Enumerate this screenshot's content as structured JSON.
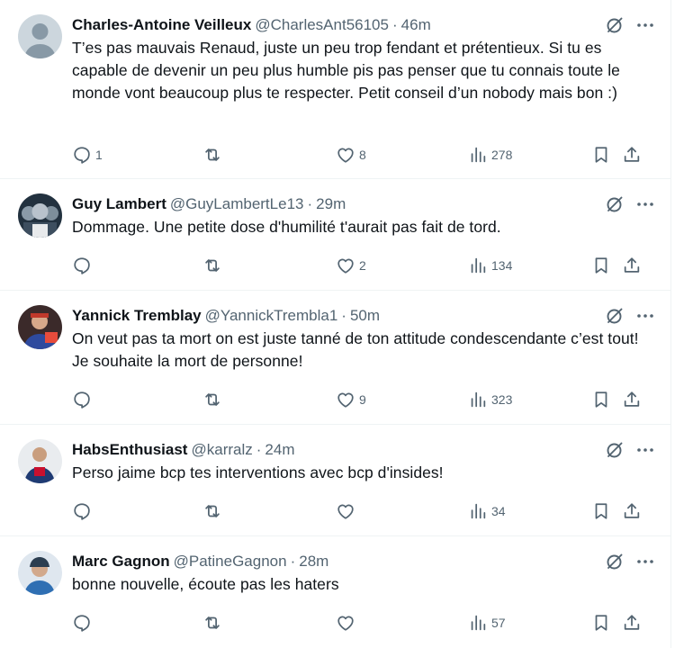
{
  "tweets": [
    {
      "name": "Charles-Antoine Veilleux",
      "handle": "@CharlesAnt56105",
      "time": "46m",
      "text": "T’es pas mauvais Renaud, juste un peu trop fendant et prétentieux. Si tu es capable de devenir un peu plus humble pis pas penser que tu connais toute le monde vont beaucoup plus te respecter. Petit conseil d’un nobody mais bon :)",
      "replies": "1",
      "retweets": "",
      "likes": "8",
      "views": "278"
    },
    {
      "name": "Guy Lambert",
      "handle": "@GuyLambertLe13",
      "time": "29m",
      "text": "Dommage. Une petite dose d'humilité t'aurait pas fait de tord.",
      "replies": "",
      "retweets": "",
      "likes": "2",
      "views": "134"
    },
    {
      "name": "Yannick Tremblay",
      "handle": "@YannickTrembla1",
      "time": "50m",
      "text": "On veut pas ta mort on est juste tanné de ton attitude condescendante c’est tout! Je souhaite la mort de personne!",
      "replies": "",
      "retweets": "",
      "likes": "9",
      "views": "323"
    },
    {
      "name": "HabsEnthusiast",
      "handle": "@karralz",
      "time": "24m",
      "text": "Perso jaime bcp tes interventions avec bcp d'insides!",
      "replies": "",
      "retweets": "",
      "likes": "",
      "views": "34"
    },
    {
      "name": "Marc Gagnon",
      "handle": "@PatineGagnon",
      "time": "28m",
      "text": "bonne nouvelle, écoute pas les haters",
      "replies": "",
      "retweets": "",
      "likes": "",
      "views": "57"
    }
  ],
  "separator": "·",
  "icons": [
    "grok-icon",
    "more-icon",
    "reply-icon",
    "retweet-icon",
    "like-icon",
    "views-icon",
    "bookmark-icon",
    "share-icon"
  ],
  "colors": {
    "text": "#0f1419",
    "secondary": "#536471",
    "border": "#eff3f4"
  }
}
